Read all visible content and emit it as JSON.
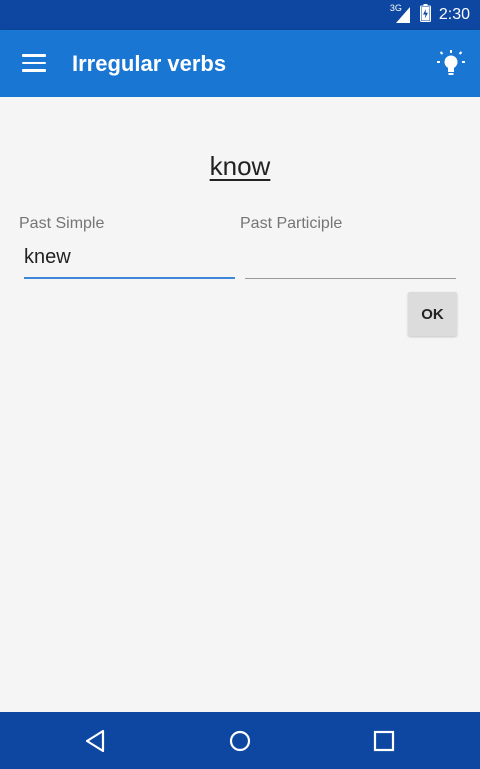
{
  "status_bar": {
    "network": "3G",
    "time": "2:30"
  },
  "app_bar": {
    "title": "Irregular verbs",
    "menu_icon": "hamburger-menu-icon",
    "action_icon": "lightbulb-icon"
  },
  "quiz": {
    "verb": "know",
    "past_simple_label": "Past Simple",
    "past_simple_value": "knew",
    "past_participle_label": "Past Participle",
    "past_participle_value": "",
    "ok_label": "OK"
  },
  "colors": {
    "status_bar": "#0d47a1",
    "app_bar": "#1976d2",
    "nav_bar": "#0d47a1",
    "accent": "#3f88d9"
  }
}
